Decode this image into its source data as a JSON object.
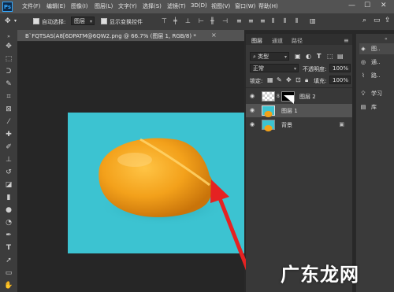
{
  "app": {
    "logo": "Ps"
  },
  "menu": {
    "items": [
      "文件(F)",
      "编辑(E)",
      "图像(I)",
      "图层(L)",
      "文字(Y)",
      "选择(S)",
      "滤镜(T)",
      "3D(D)",
      "视图(V)",
      "窗口(W)",
      "帮助(H)"
    ]
  },
  "window_controls": {
    "minimize": "—",
    "maximize": "☐",
    "close": "✕"
  },
  "options": {
    "auto_select_label": "自动选择:",
    "auto_select_value": "图层",
    "show_transform_label": "显示变换控件"
  },
  "document": {
    "tab_title": "B`FQTSAS(A8[6DPATM@6QW2.png @ 66.7% (图层 1, RGB/8) *",
    "tab_close": "×"
  },
  "panels": {
    "tabs": [
      "图层",
      "通道",
      "路径"
    ],
    "filter_kind": "类型",
    "blend_mode": "正常",
    "opacity_label": "不透明度:",
    "opacity_value": "100%",
    "lock_label": "锁定:",
    "fill_label": "填充:",
    "fill_value": "100%",
    "layers": [
      {
        "name": "图层 2",
        "visible": true,
        "selected": false
      },
      {
        "name": "图层 1",
        "visible": true,
        "selected": true
      },
      {
        "name": "背景",
        "visible": true,
        "selected": false,
        "locked": true
      }
    ]
  },
  "dock": {
    "items": [
      {
        "label": "图..",
        "icon": "layers-icon"
      },
      {
        "label": "通..",
        "icon": "channels-icon"
      },
      {
        "label": "路..",
        "icon": "paths-icon"
      },
      {
        "label": "学习",
        "icon": "learn-icon"
      },
      {
        "label": "库",
        "icon": "library-icon"
      }
    ]
  },
  "watermark": {
    "text": "广东龙网"
  },
  "colors": {
    "canvas_bg": "#3cc3d1",
    "lemon": "#f2a21a",
    "arrow": "#e52222"
  }
}
